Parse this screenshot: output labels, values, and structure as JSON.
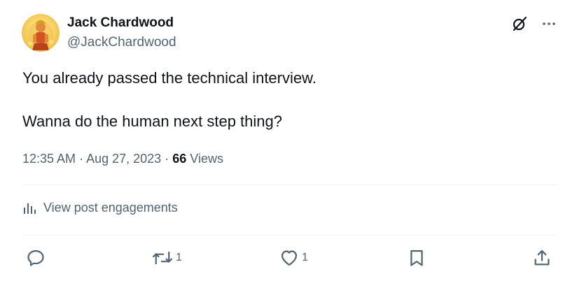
{
  "author": {
    "name": "Jack Chardwood",
    "handle": "@JackChardwood"
  },
  "post": {
    "line1": "You already passed the technical interview.",
    "line2": "Wanna do the human next step thing?"
  },
  "meta": {
    "time": "12:35 AM",
    "separator": "·",
    "date": "Aug 27, 2023",
    "views_count": "66",
    "views_label": "Views"
  },
  "engagements": {
    "label": "View post engagements"
  },
  "actions": {
    "reply_count": "",
    "repost_count": "1",
    "like_count": "1"
  },
  "icons": {
    "grok": "grok-icon",
    "more": "more-icon",
    "analytics": "analytics-icon",
    "reply": "reply-icon",
    "repost": "repost-icon",
    "like": "heart-icon",
    "bookmark": "bookmark-icon",
    "share": "share-icon"
  },
  "colors": {
    "text": "#0f1419",
    "secondary": "#536471",
    "divider": "#eff3f4"
  }
}
